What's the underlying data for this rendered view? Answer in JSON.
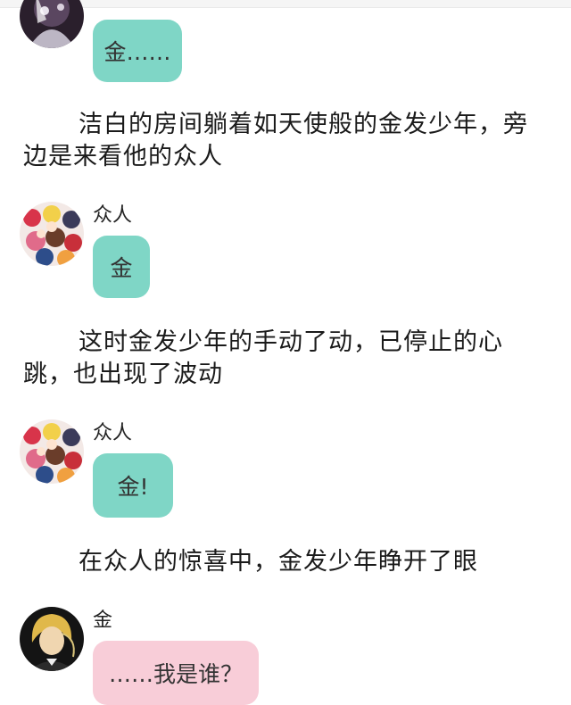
{
  "messages": [
    {
      "type": "bubble",
      "speaker": "",
      "avatar": "dark-character-avatar",
      "text": "金……",
      "color": "#7fd6c6"
    },
    {
      "type": "narration",
      "line1": "洁白的房间躺着如天使般的金发少年，旁",
      "line2": "边是来看他的众人"
    },
    {
      "type": "bubble",
      "speaker": "众人",
      "avatar": "group-anime-avatar",
      "text": "金",
      "color": "#7fd6c6"
    },
    {
      "type": "narration",
      "line1": "这时金发少年的手动了动，已停止的心",
      "line2": "跳，也出现了波动"
    },
    {
      "type": "bubble",
      "speaker": "众人",
      "avatar": "group-anime-avatar",
      "text": "金!",
      "color": "#7fd6c6"
    },
    {
      "type": "narration",
      "line1": "在众人的惊喜中，金发少年睁开了眼"
    },
    {
      "type": "bubble",
      "speaker": "金",
      "avatar": "blond-boy-avatar",
      "text": "……我是谁？",
      "color": "#f8cdd8"
    }
  ]
}
